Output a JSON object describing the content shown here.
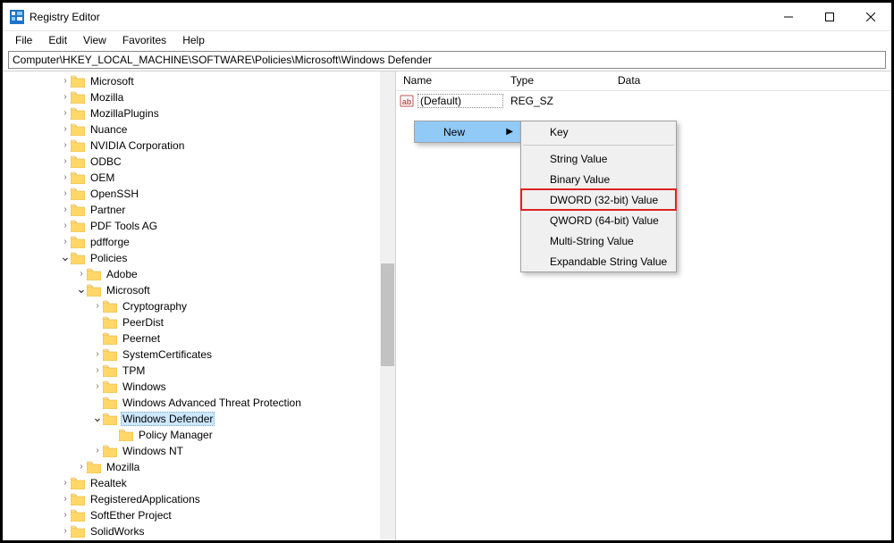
{
  "window": {
    "title": "Registry Editor"
  },
  "menubar": [
    "File",
    "Edit",
    "View",
    "Favorites",
    "Help"
  ],
  "address": "Computer\\HKEY_LOCAL_MACHINE\\SOFTWARE\\Policies\\Microsoft\\Windows Defender",
  "tree": [
    {
      "indent": 4,
      "label": "Microsoft",
      "twisty": ">"
    },
    {
      "indent": 4,
      "label": "Mozilla",
      "twisty": ">"
    },
    {
      "indent": 4,
      "label": "MozillaPlugins",
      "twisty": ">"
    },
    {
      "indent": 4,
      "label": "Nuance",
      "twisty": ">"
    },
    {
      "indent": 4,
      "label": "NVIDIA Corporation",
      "twisty": ">"
    },
    {
      "indent": 4,
      "label": "ODBC",
      "twisty": ">"
    },
    {
      "indent": 4,
      "label": "OEM",
      "twisty": ">"
    },
    {
      "indent": 4,
      "label": "OpenSSH",
      "twisty": ">"
    },
    {
      "indent": 4,
      "label": "Partner",
      "twisty": ">"
    },
    {
      "indent": 4,
      "label": "PDF Tools AG",
      "twisty": ">"
    },
    {
      "indent": 4,
      "label": "pdfforge",
      "twisty": ">"
    },
    {
      "indent": 4,
      "label": "Policies",
      "twisty": "v"
    },
    {
      "indent": 5,
      "label": "Adobe",
      "twisty": ">"
    },
    {
      "indent": 5,
      "label": "Microsoft",
      "twisty": "v"
    },
    {
      "indent": 6,
      "label": "Cryptography",
      "twisty": ">"
    },
    {
      "indent": 6,
      "label": "PeerDist",
      "twisty": ""
    },
    {
      "indent": 6,
      "label": "Peernet",
      "twisty": ""
    },
    {
      "indent": 6,
      "label": "SystemCertificates",
      "twisty": ">"
    },
    {
      "indent": 6,
      "label": "TPM",
      "twisty": ">"
    },
    {
      "indent": 6,
      "label": "Windows",
      "twisty": ">"
    },
    {
      "indent": 6,
      "label": "Windows Advanced Threat Protection",
      "twisty": ""
    },
    {
      "indent": 6,
      "label": "Windows Defender",
      "twisty": "v",
      "selected": true
    },
    {
      "indent": 7,
      "label": "Policy Manager",
      "twisty": ""
    },
    {
      "indent": 6,
      "label": "Windows NT",
      "twisty": ">"
    },
    {
      "indent": 5,
      "label": "Mozilla",
      "twisty": ">"
    },
    {
      "indent": 4,
      "label": "Realtek",
      "twisty": ">"
    },
    {
      "indent": 4,
      "label": "RegisteredApplications",
      "twisty": ">"
    },
    {
      "indent": 4,
      "label": "SoftEther Project",
      "twisty": ">"
    },
    {
      "indent": 4,
      "label": "SolidWorks",
      "twisty": ">",
      "cut": true
    }
  ],
  "list": {
    "headers": {
      "name": "Name",
      "type": "Type",
      "data": "Data"
    },
    "rows": [
      {
        "name": "(Default)",
        "type": "REG_SZ",
        "data": ""
      }
    ]
  },
  "context_menu": {
    "primary": {
      "label": "New"
    },
    "submenu": [
      {
        "label": "Key",
        "sep_after": true
      },
      {
        "label": "String Value"
      },
      {
        "label": "Binary Value"
      },
      {
        "label": "DWORD (32-bit) Value",
        "highlight": true
      },
      {
        "label": "QWORD (64-bit) Value"
      },
      {
        "label": "Multi-String Value"
      },
      {
        "label": "Expandable String Value"
      }
    ]
  }
}
